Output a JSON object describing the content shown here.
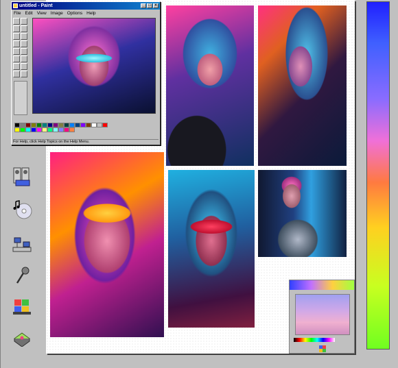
{
  "paint_window": {
    "title": "untitled - Paint",
    "menus": [
      "File",
      "Edit",
      "View",
      "Image",
      "Options",
      "Help"
    ],
    "status_text": "For Help, click Help Topics on the Help Menu.",
    "palette_colors": [
      "#000000",
      "#808080",
      "#800000",
      "#808000",
      "#008000",
      "#008080",
      "#000080",
      "#800080",
      "#808040",
      "#004040",
      "#0080ff",
      "#004080",
      "#8000ff",
      "#804000",
      "#ffffff",
      "#c0c0c0",
      "#ff0000",
      "#ffff00",
      "#00ff00",
      "#00ffff",
      "#0000ff",
      "#ff00ff",
      "#ffff80",
      "#00ff80",
      "#80ffff",
      "#8080ff",
      "#ff0080",
      "#ff8040"
    ]
  },
  "sidebar_icons": [
    "media-player-icon",
    "cd-player-icon",
    "network-icon",
    "microphone-icon",
    "windows-logo-icon",
    "drive-icon"
  ],
  "images": [
    "cyberpunk-girl-visor-image",
    "neon-catwoman-image",
    "android-profile-image",
    "yellow-goggles-girl-image",
    "red-glasses-girl-image",
    "cyborg-woman-image"
  ],
  "mini_window": {
    "label": "small paint thumbnail"
  }
}
